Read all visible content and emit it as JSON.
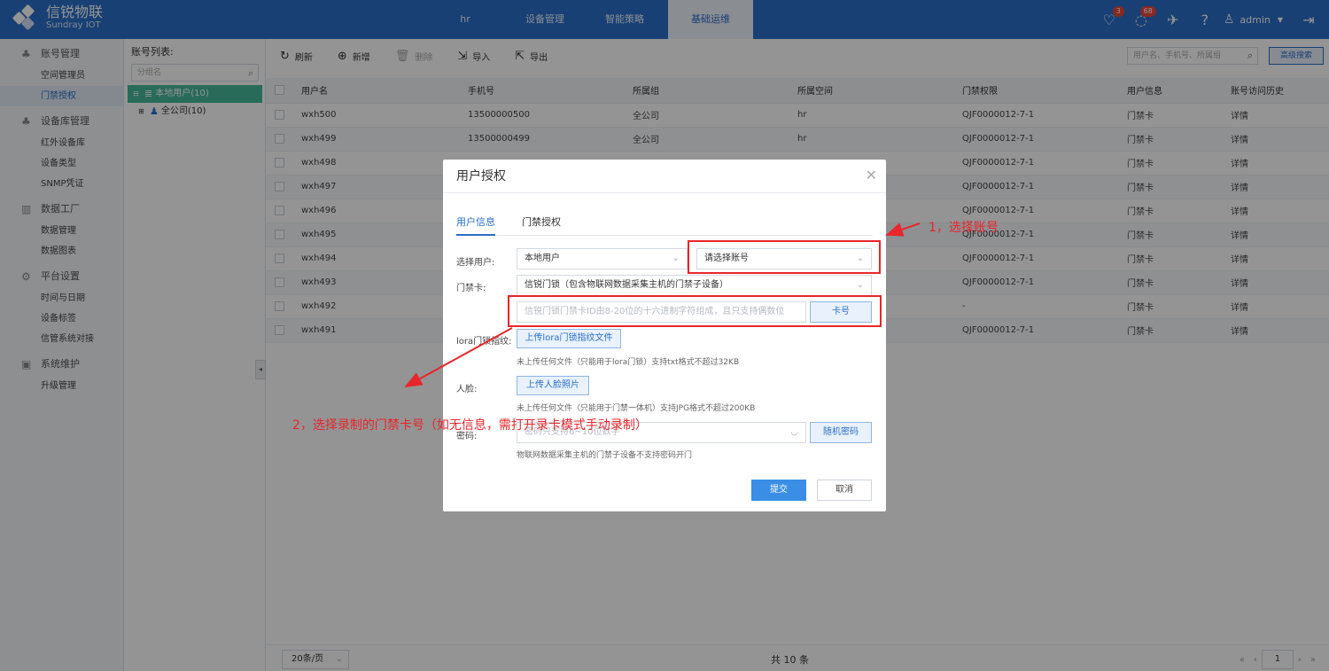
{
  "brand": {
    "title": "信锐物联",
    "subtitle": "Sundray IOT"
  },
  "nav": [
    "hr",
    "设备管理",
    "智能策略",
    "基础运维"
  ],
  "topbar": {
    "bell_badge": "3",
    "message_badge": "68",
    "user": "admin"
  },
  "sidebar": {
    "groups": [
      {
        "label": "账号管理",
        "items": [
          "空间管理员",
          "门禁授权"
        ]
      },
      {
        "label": "设备库管理",
        "items": [
          "红外设备库",
          "设备类型",
          "SNMP凭证"
        ]
      },
      {
        "label": "数据工厂",
        "items": [
          "数据管理",
          "数据图表"
        ]
      },
      {
        "label": "平台设置",
        "items": [
          "时间与日期",
          "设备标签",
          "信管系统对接"
        ]
      },
      {
        "label": "系统维护",
        "items": [
          "升级管理"
        ]
      }
    ]
  },
  "tree": {
    "title": "账号列表:",
    "search_placeholder": "分组名",
    "nodes": [
      "本地用户(10)",
      "全公司(10)"
    ]
  },
  "toolbar": {
    "refresh": "刷新",
    "add": "新增",
    "delete": "删除",
    "import": "导入",
    "export": "导出",
    "search_placeholder": "用户名、手机号、所属组",
    "advanced": "高级搜索"
  },
  "table": {
    "headers": [
      "用户名",
      "手机号",
      "所属组",
      "所属空间",
      "门禁权限",
      "用户信息",
      "账号访问历史"
    ],
    "rows": [
      [
        "wxh500",
        "13500000500",
        "全公司",
        "hr",
        "QJF0000012-7-1",
        "门禁卡",
        "详情"
      ],
      [
        "wxh499",
        "13500000499",
        "全公司",
        "hr",
        "QJF0000012-7-1",
        "门禁卡",
        "详情"
      ],
      [
        "wxh498",
        "",
        "",
        "",
        "QJF0000012-7-1",
        "门禁卡",
        "详情"
      ],
      [
        "wxh497",
        "",
        "",
        "",
        "QJF0000012-7-1",
        "门禁卡",
        "详情"
      ],
      [
        "wxh496",
        "",
        "",
        "",
        "QJF0000012-7-1",
        "门禁卡",
        "详情"
      ],
      [
        "wxh495",
        "",
        "",
        "",
        "QJF0000012-7-1",
        "门禁卡",
        "详情"
      ],
      [
        "wxh494",
        "",
        "",
        "",
        "QJF0000012-7-1",
        "门禁卡",
        "详情"
      ],
      [
        "wxh493",
        "",
        "",
        "",
        "QJF0000012-7-1",
        "门禁卡",
        "详情"
      ],
      [
        "wxh492",
        "",
        "",
        "",
        "-",
        "门禁卡",
        "详情"
      ],
      [
        "wxh491",
        "",
        "",
        "",
        "QJF0000012-7-1",
        "门禁卡",
        "详情"
      ]
    ]
  },
  "pager": {
    "page_size": "20条/页",
    "total": "共 10 条",
    "current": "1"
  },
  "dialog": {
    "title": "用户授权",
    "tabs": [
      "用户信息",
      "门禁授权"
    ],
    "select_user_label": "选择用户:",
    "user_type": "本地用户",
    "account_placeholder": "请选择账号",
    "card_label": "门禁卡:",
    "card_type": "信锐门锁（包含物联网数据采集主机的门禁子设备）",
    "card_id_placeholder": "信锐门锁门禁卡ID由8-20位的十六进制字符组成，且只支持偶数位",
    "card_button": "卡号",
    "lora_label": "lora门锁指纹:",
    "lora_button": "上传lora门锁指纹文件",
    "lora_hint": "未上传任何文件（只能用于lora门锁）支持txt格式不超过32KB",
    "face_label": "人脸:",
    "face_button": "上传人脸照片",
    "face_hint": "未上传任何文件（只能用于门禁一体机）支持JPG格式不超过200KB",
    "password_label": "密码:",
    "password_placeholder": "密码只支持6~10位数字",
    "random_password": "随机密码",
    "password_hint": "物联网数据采集主机的门禁子设备不支持密码开门",
    "submit": "提交",
    "cancel": "取消"
  },
  "annotations": {
    "step1": "1，选择账号",
    "step2": "2，选择录制的门禁卡号（如无信息，需打开录卡模式手动录制）"
  }
}
